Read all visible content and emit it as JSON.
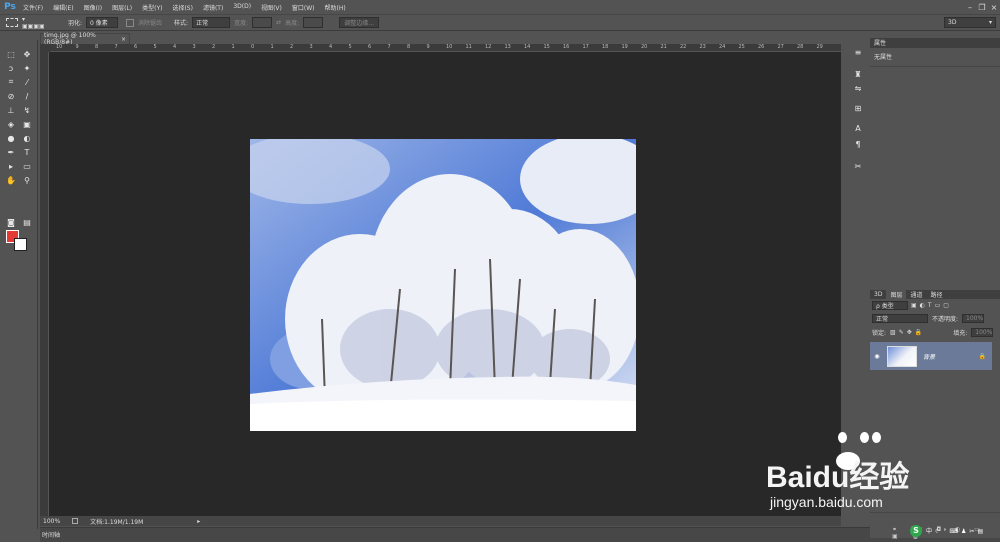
{
  "app": {
    "logo": "Ps",
    "workspace": "3D"
  },
  "menu": [
    "文件(F)",
    "编辑(E)",
    "图像(I)",
    "图层(L)",
    "类型(Y)",
    "选择(S)",
    "滤镜(T)",
    "3D(D)",
    "视图(V)",
    "窗口(W)",
    "帮助(H)"
  ],
  "options": {
    "feather_label": "羽化:",
    "feather_value": "0 像素",
    "antialias_label": "消除锯齿",
    "style_label": "样式:",
    "style_value": "正常",
    "width_label": "宽度:",
    "height_label": "高度:",
    "refine_edge": "调整边缘..."
  },
  "document": {
    "tab_title": "timg.jpg @ 100%(RGB/8#)",
    "close": "×"
  },
  "ruler": {
    "h_ticks": [
      "10",
      "9",
      "8",
      "7",
      "6",
      "5",
      "4",
      "3",
      "2",
      "1",
      "0",
      "1",
      "2",
      "3",
      "4",
      "5",
      "6",
      "7",
      "8",
      "9",
      "10",
      "11",
      "12",
      "13",
      "14",
      "15",
      "16",
      "17",
      "18",
      "19",
      "20",
      "21",
      "22",
      "23",
      "24",
      "25",
      "26",
      "27",
      "28",
      "29"
    ]
  },
  "status": {
    "zoom": "100%",
    "doc_info": "文档:1.19M/1.19M"
  },
  "timeline": {
    "label": "时间轴"
  },
  "properties": {
    "tab": "属性",
    "empty": "无属性"
  },
  "layers_panel": {
    "tabs": [
      "3D",
      "图层",
      "通道",
      "路径"
    ],
    "filter_label": "ρ 类型",
    "blend_mode": "正常",
    "opacity_label": "不透明度:",
    "opacity_value": "100%",
    "lock_label": "锁定:",
    "fill_label": "填充:",
    "fill_value": "100%",
    "layer_name": "背景"
  },
  "colors": {
    "foreground": "#e53935",
    "background": "#ffffff",
    "canvas_bg": "#282828",
    "ui_bg": "#535353",
    "layer_selected": "#6c7a99"
  },
  "watermark": {
    "brand": "Baidu经验",
    "url": "jingyan.baidu.com"
  },
  "tray_badge": "S"
}
